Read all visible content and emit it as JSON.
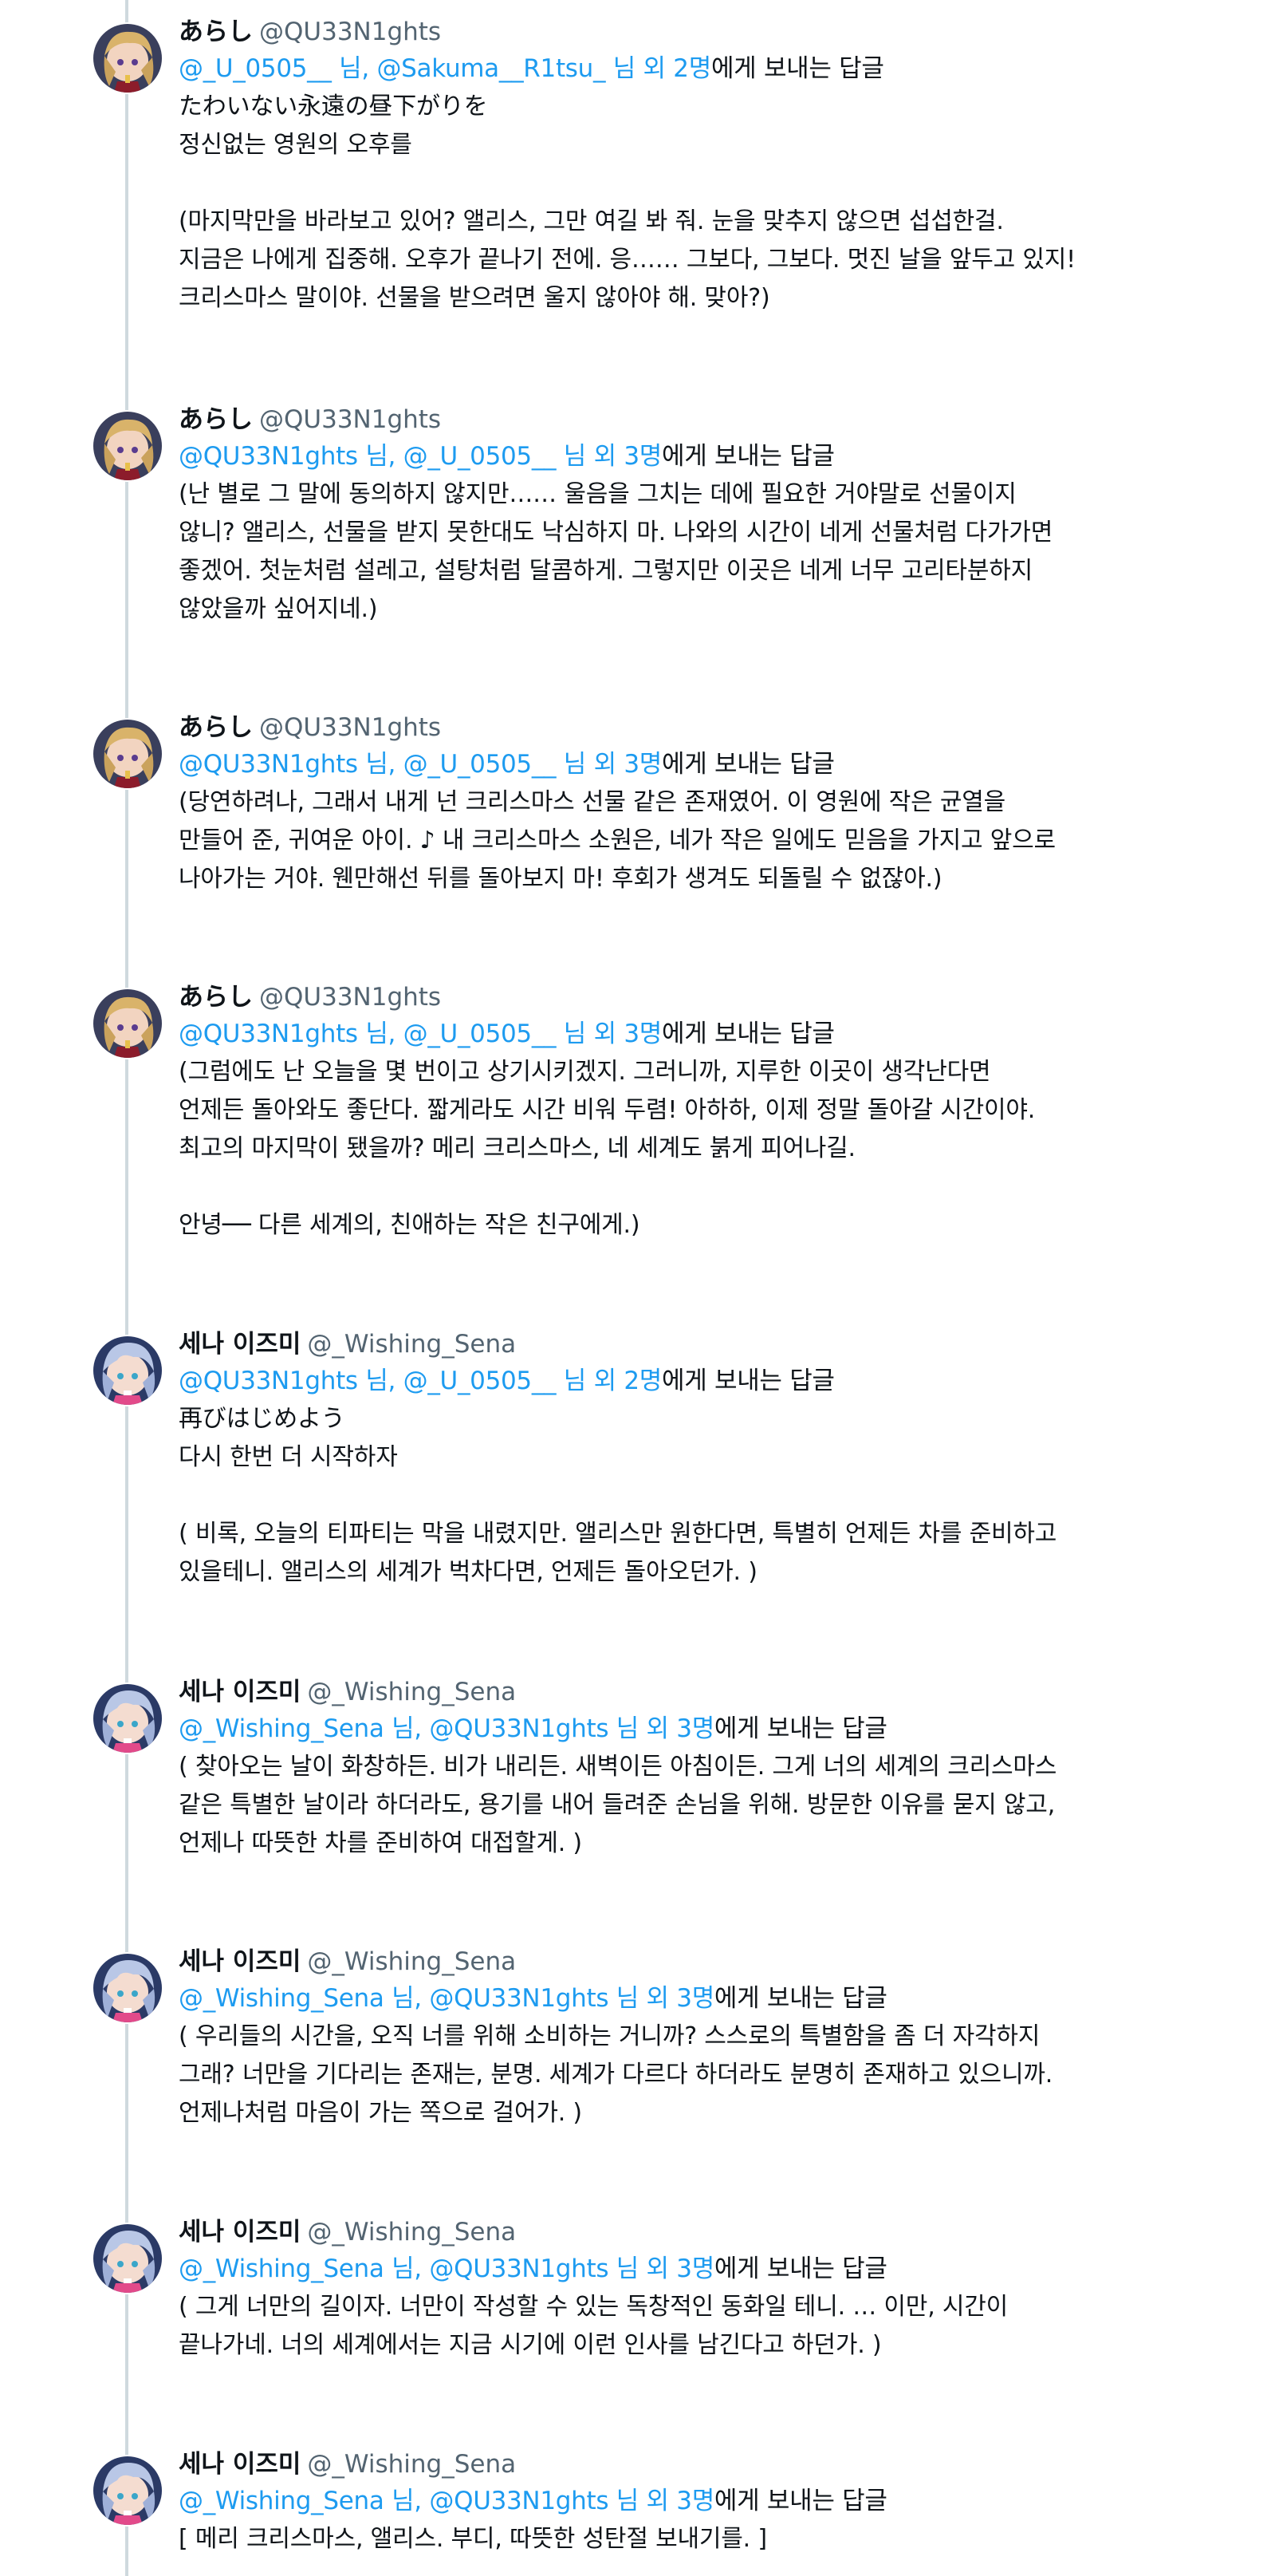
{
  "colors": {
    "link": "#1d9bf0",
    "text": "#0f1419",
    "muted": "#536471",
    "thread_line": "#cfd9de"
  },
  "tweets": [
    {
      "author": "あらし",
      "handle": "@QU33N1ghts",
      "avatar": "arashi-avatar",
      "reply_targets": "@_U_0505__ 님, @Sakuma__R1tsu_ 님 외 2명",
      "reply_suffix": "에게 보내는 답글",
      "body": "たわいない永遠の昼下がりを\n정신없는 영원의 오후를\n\n(마지막만을 바라보고 있어? 앨리스, 그만 여길 봐 줘. 눈을 맞추지 않으면 섭섭한걸.\n지금은 나에게 집중해. 오후가 끝나기 전에. 응…… 그보다, 그보다. 멋진 날을 앞두고 있지!\n크리스마스 말이야. 선물을 받으려면 울지 않아야 해. 맞아?)"
    },
    {
      "author": "あらし",
      "handle": "@QU33N1ghts",
      "avatar": "arashi-avatar",
      "reply_targets": "@QU33N1ghts 님, @_U_0505__ 님 외 3명",
      "reply_suffix": "에게 보내는 답글",
      "body": "(난 별로 그 말에 동의하지 않지만…… 울음을 그치는 데에 필요한 거야말로 선물이지\n않니? 앨리스, 선물을 받지 못한대도 낙심하지 마. 나와의 시간이 네게 선물처럼 다가가면\n좋겠어. 첫눈처럼 설레고, 설탕처럼 달콤하게. 그렇지만 이곳은 네게 너무 고리타분하지\n않았을까 싶어지네.)"
    },
    {
      "author": "あらし",
      "handle": "@QU33N1ghts",
      "avatar": "arashi-avatar",
      "reply_targets": "@QU33N1ghts 님, @_U_0505__ 님 외 3명",
      "reply_suffix": "에게 보내는 답글",
      "body": "(당연하려나, 그래서 내게 넌 크리스마스 선물 같은 존재였어. 이 영원에 작은 균열을\n만들어 준, 귀여운 아이. ♪ 내 크리스마스 소원은, 네가 작은 일에도 믿음을 가지고 앞으로\n나아가는 거야. 웬만해선 뒤를 돌아보지 마! 후회가 생겨도 되돌릴 수 없잖아.)"
    },
    {
      "author": "あらし",
      "handle": "@QU33N1ghts",
      "avatar": "arashi-avatar",
      "reply_targets": "@QU33N1ghts 님, @_U_0505__ 님 외 3명",
      "reply_suffix": "에게 보내는 답글",
      "body": "(그럼에도 난 오늘을 몇 번이고 상기시키겠지. 그러니까, 지루한 이곳이 생각난다면\n언제든 돌아와도 좋단다. 짧게라도 시간 비워 두렴! 아하하, 이제 정말 돌아갈 시간이야.\n최고의 마지막이 됐을까? 메리 크리스마스, 네 세계도 붉게 피어나길.\n\n안녕── 다른 세계의, 친애하는 작은 친구에게.)"
    },
    {
      "author": "세나 이즈미",
      "handle": "@_Wishing_Sena",
      "avatar": "sena-avatar",
      "reply_targets": "@QU33N1ghts 님, @_U_0505__ 님 외 2명",
      "reply_suffix": "에게 보내는 답글",
      "body": "再びはじめよう\n다시 한번 더 시작하자\n\n( 비록, 오늘의 티파티는 막을 내렸지만. 앨리스만 원한다면, 특별히 언제든 차를 준비하고\n있을테니. 앨리스의 세계가 벅차다면, 언제든 돌아오던가. )"
    },
    {
      "author": "세나 이즈미",
      "handle": "@_Wishing_Sena",
      "avatar": "sena-avatar",
      "reply_targets": "@_Wishing_Sena 님, @QU33N1ghts 님 외 3명",
      "reply_suffix": "에게 보내는 답글",
      "body": "( 찾아오는 날이 화창하든. 비가 내리든. 새벽이든 아침이든. 그게 너의 세계의 크리스마스\n같은 특별한 날이라 하더라도, 용기를 내어 들려준 손님을 위해. 방문한 이유를 묻지 않고,\n언제나 따뜻한 차를 준비하여 대접할게. )"
    },
    {
      "author": "세나 이즈미",
      "handle": "@_Wishing_Sena",
      "avatar": "sena-avatar",
      "reply_targets": "@_Wishing_Sena 님, @QU33N1ghts 님 외 3명",
      "reply_suffix": "에게 보내는 답글",
      "body": "( 우리들의 시간을, 오직 너를 위해 소비하는 거니까? 스스로의 특별함을 좀 더 자각하지\n그래? 너만을 기다리는 존재는, 분명. 세계가 다르다 하더라도 분명히 존재하고 있으니까.\n언제나처럼 마음이 가는 쪽으로 걸어가. )"
    },
    {
      "author": "세나 이즈미",
      "handle": "@_Wishing_Sena",
      "avatar": "sena-avatar",
      "reply_targets": "@_Wishing_Sena 님, @QU33N1ghts 님 외 3명",
      "reply_suffix": "에게 보내는 답글",
      "body": "( 그게 너만의 길이자. 너만이 작성할 수 있는 독창적인 동화일 테니. … 이만, 시간이\n끝나가네. 너의 세계에서는 지금 시기에 이런 인사를 남긴다고 하던가. )"
    },
    {
      "author": "세나 이즈미",
      "handle": "@_Wishing_Sena",
      "avatar": "sena-avatar",
      "reply_targets": "@_Wishing_Sena 님, @QU33N1ghts 님 외 3명",
      "reply_suffix": "에게 보내는 답글",
      "body": "[ 메리 크리스마스, 앨리스. 부디, 따뜻한 성탄절 보내기를. ]"
    }
  ]
}
